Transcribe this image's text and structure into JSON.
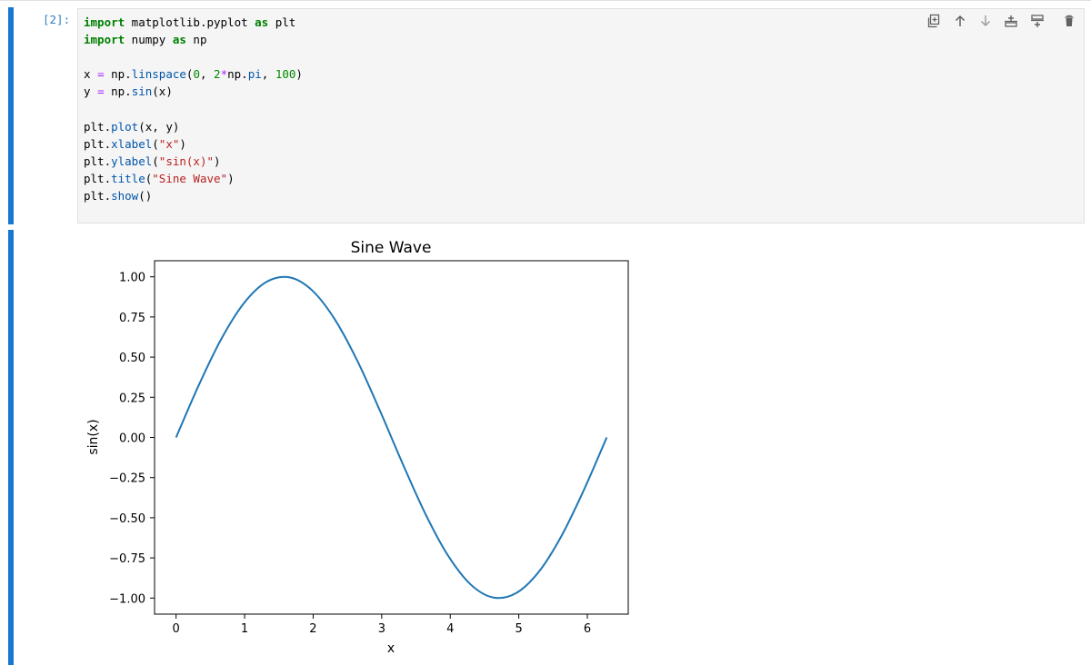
{
  "cell": {
    "prompt": "[2]:",
    "code_lines": [
      [
        {
          "t": "import",
          "c": "kw"
        },
        {
          "t": " matplotlib.pyplot ",
          "c": ""
        },
        {
          "t": "as",
          "c": "kw"
        },
        {
          "t": " plt",
          "c": ""
        }
      ],
      [
        {
          "t": "import",
          "c": "kw"
        },
        {
          "t": " numpy ",
          "c": ""
        },
        {
          "t": "as",
          "c": "kw"
        },
        {
          "t": " np",
          "c": ""
        }
      ],
      [],
      [
        {
          "t": "x ",
          "c": ""
        },
        {
          "t": "=",
          "c": "op"
        },
        {
          "t": " np.",
          "c": ""
        },
        {
          "t": "linspace",
          "c": "fn"
        },
        {
          "t": "(",
          "c": ""
        },
        {
          "t": "0",
          "c": "nm"
        },
        {
          "t": ", ",
          "c": ""
        },
        {
          "t": "2",
          "c": "nm"
        },
        {
          "t": "*",
          "c": "op"
        },
        {
          "t": "np.",
          "c": ""
        },
        {
          "t": "pi",
          "c": "fn"
        },
        {
          "t": ", ",
          "c": ""
        },
        {
          "t": "100",
          "c": "nm"
        },
        {
          "t": ")",
          "c": ""
        }
      ],
      [
        {
          "t": "y ",
          "c": ""
        },
        {
          "t": "=",
          "c": "op"
        },
        {
          "t": " np.",
          "c": ""
        },
        {
          "t": "sin",
          "c": "fn"
        },
        {
          "t": "(x)",
          "c": ""
        }
      ],
      [],
      [
        {
          "t": "plt.",
          "c": ""
        },
        {
          "t": "plot",
          "c": "fn"
        },
        {
          "t": "(x, y)",
          "c": ""
        }
      ],
      [
        {
          "t": "plt.",
          "c": ""
        },
        {
          "t": "xlabel",
          "c": "fn"
        },
        {
          "t": "(",
          "c": ""
        },
        {
          "t": "\"x\"",
          "c": "st"
        },
        {
          "t": ")",
          "c": ""
        }
      ],
      [
        {
          "t": "plt.",
          "c": ""
        },
        {
          "t": "ylabel",
          "c": "fn"
        },
        {
          "t": "(",
          "c": ""
        },
        {
          "t": "\"sin(x)\"",
          "c": "st"
        },
        {
          "t": ")",
          "c": ""
        }
      ],
      [
        {
          "t": "plt.",
          "c": ""
        },
        {
          "t": "title",
          "c": "fn"
        },
        {
          "t": "(",
          "c": ""
        },
        {
          "t": "\"Sine Wave\"",
          "c": "st"
        },
        {
          "t": ")",
          "c": ""
        }
      ],
      [
        {
          "t": "plt.",
          "c": ""
        },
        {
          "t": "show",
          "c": "fn"
        },
        {
          "t": "()",
          "c": ""
        }
      ]
    ]
  },
  "toolbar": {
    "buttons": [
      {
        "name": "duplicate-cell-icon",
        "label": "Duplicate"
      },
      {
        "name": "move-up-icon",
        "label": "Move up"
      },
      {
        "name": "move-down-icon",
        "label": "Move down"
      },
      {
        "name": "insert-above-icon",
        "label": "Insert above"
      },
      {
        "name": "insert-below-icon",
        "label": "Insert below"
      },
      {
        "name": "delete-icon",
        "label": "Delete"
      }
    ]
  },
  "colors": {
    "accent": "#1976d2",
    "line": "#1f77b4"
  },
  "chart_data": {
    "type": "line",
    "title": "Sine Wave",
    "xlabel": "x",
    "ylabel": "sin(x)",
    "xlim": [
      -0.314,
      6.597
    ],
    "ylim": [
      -1.1,
      1.1
    ],
    "xticks": [
      0,
      1,
      2,
      3,
      4,
      5,
      6
    ],
    "xtick_labels": [
      "0",
      "1",
      "2",
      "3",
      "4",
      "5",
      "6"
    ],
    "yticks": [
      1.0,
      0.75,
      0.5,
      0.25,
      0.0,
      -0.25,
      -0.5,
      -0.75,
      -1.0
    ],
    "ytick_labels": [
      "1.00",
      "0.75",
      "0.50",
      "0.25",
      "0.00",
      "−0.25",
      "−0.50",
      "−0.75",
      "−1.00"
    ],
    "grid": false,
    "series": [
      {
        "x": [
          0,
          0.3307,
          0.6614,
          0.9921,
          1.3228,
          1.6535,
          1.9842,
          2.3149,
          2.6456,
          2.9762,
          3.3069,
          3.6376,
          3.9683,
          4.299,
          4.6297,
          4.9604,
          5.2911,
          5.6218,
          5.9525,
          6.2832
        ],
        "y": [
          0,
          0.3247,
          0.6142,
          0.8372,
          0.9694,
          0.9966,
          0.9158,
          0.7357,
          0.4759,
          0.1646,
          -0.1646,
          -0.4759,
          -0.7357,
          -0.9158,
          -0.9966,
          -0.9694,
          -0.8372,
          -0.6142,
          -0.3247,
          0
        ]
      }
    ]
  }
}
